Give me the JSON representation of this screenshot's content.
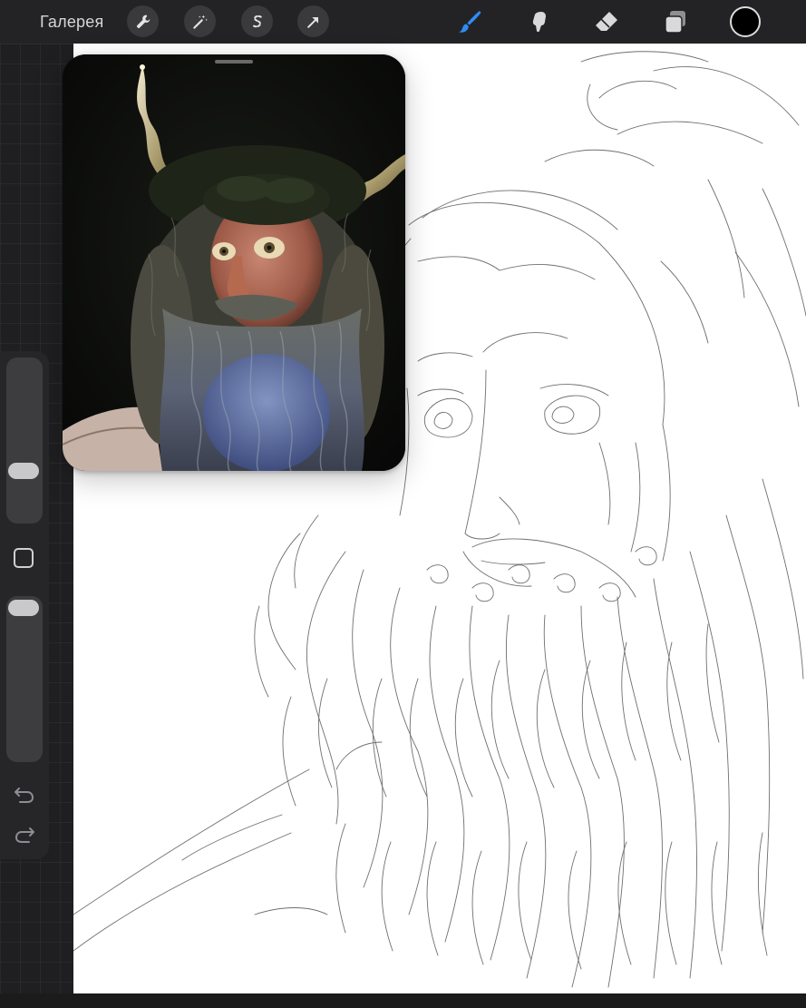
{
  "app": {
    "gallery_label": "Галерея"
  },
  "toolbar": {
    "left_tools": [
      "wrench-icon",
      "magic-wand-icon",
      "selection-s-icon",
      "transform-arrow-icon"
    ],
    "right_tools": [
      "brush-icon",
      "smudge-icon",
      "eraser-icon",
      "layers-icon"
    ],
    "active_tool": "brush",
    "current_color": "#000000",
    "accent_color": "#2f8cf3"
  },
  "sidebar": {
    "brush_size_level": 0.35,
    "opacity_level": 0.05,
    "controls": [
      "brush-size-slider",
      "modify-button",
      "opacity-slider",
      "undo-icon",
      "redo-icon"
    ]
  },
  "reference": {
    "kind": "reference-image-window"
  }
}
